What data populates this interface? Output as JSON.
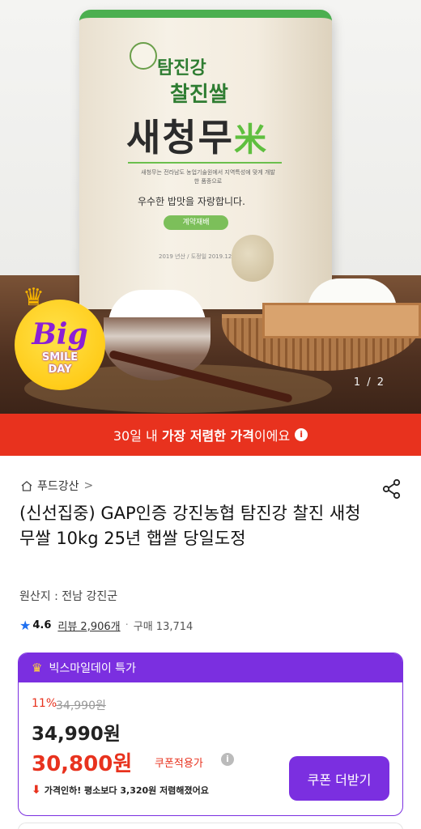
{
  "product_image": {
    "bag": {
      "line1": "탐진강",
      "line2": "찰진쌀",
      "brand": "새청무",
      "brand_mark": "米",
      "slogan": "우수한 밥맛을 자랑합니다.",
      "tag": "계약재배",
      "small_text": "새청무는 전라남도 농업기술원에서 지역특성에 맞게 개발한 품종으로",
      "date_text": "2019 년산 / 도정일 2019.12.12"
    },
    "badge": {
      "word": "Big",
      "line2": "SMILE",
      "line3": "DAY"
    },
    "counter": "1 / 2"
  },
  "lowest_price_banner": {
    "prefix": "30일 내 ",
    "bold": "가장 저렴한 가격",
    "suffix": "이에요",
    "info_icon": "i"
  },
  "store": {
    "name": "푸드강산",
    "chevron": ">"
  },
  "product": {
    "title": "(신선집중) GAP인증 강진농협 탐진강 찰진 새청무쌀 10kg 25년 햅쌀 당일도정",
    "origin": "원산지 : 전남 강진군"
  },
  "rating": {
    "score": "4.6",
    "reviews": "리뷰 2,906개",
    "separator": "·",
    "sales": "구매 13,714"
  },
  "deal": {
    "header": "빅스마일데이 특가",
    "discount_pct": "11%",
    "original_price": "34,990원",
    "price": "34,990원",
    "coupon_price": "30,800원",
    "coupon_label": "쿠폰적용가",
    "price_drop": "가격인하! 평소보다 3,320원 저렴해졌어요",
    "coupon_button": "쿠폰 더받기"
  },
  "colors": {
    "accent_red": "#e8321e",
    "accent_purple": "#7b2fe0",
    "rating_blue": "#1e6ff0"
  },
  "icons": {
    "store": "home-icon",
    "share": "share-icon",
    "rating": "star-icon",
    "deal_header": "crown-icon",
    "price_drop": "arrow-down-icon",
    "info": "info-icon"
  }
}
